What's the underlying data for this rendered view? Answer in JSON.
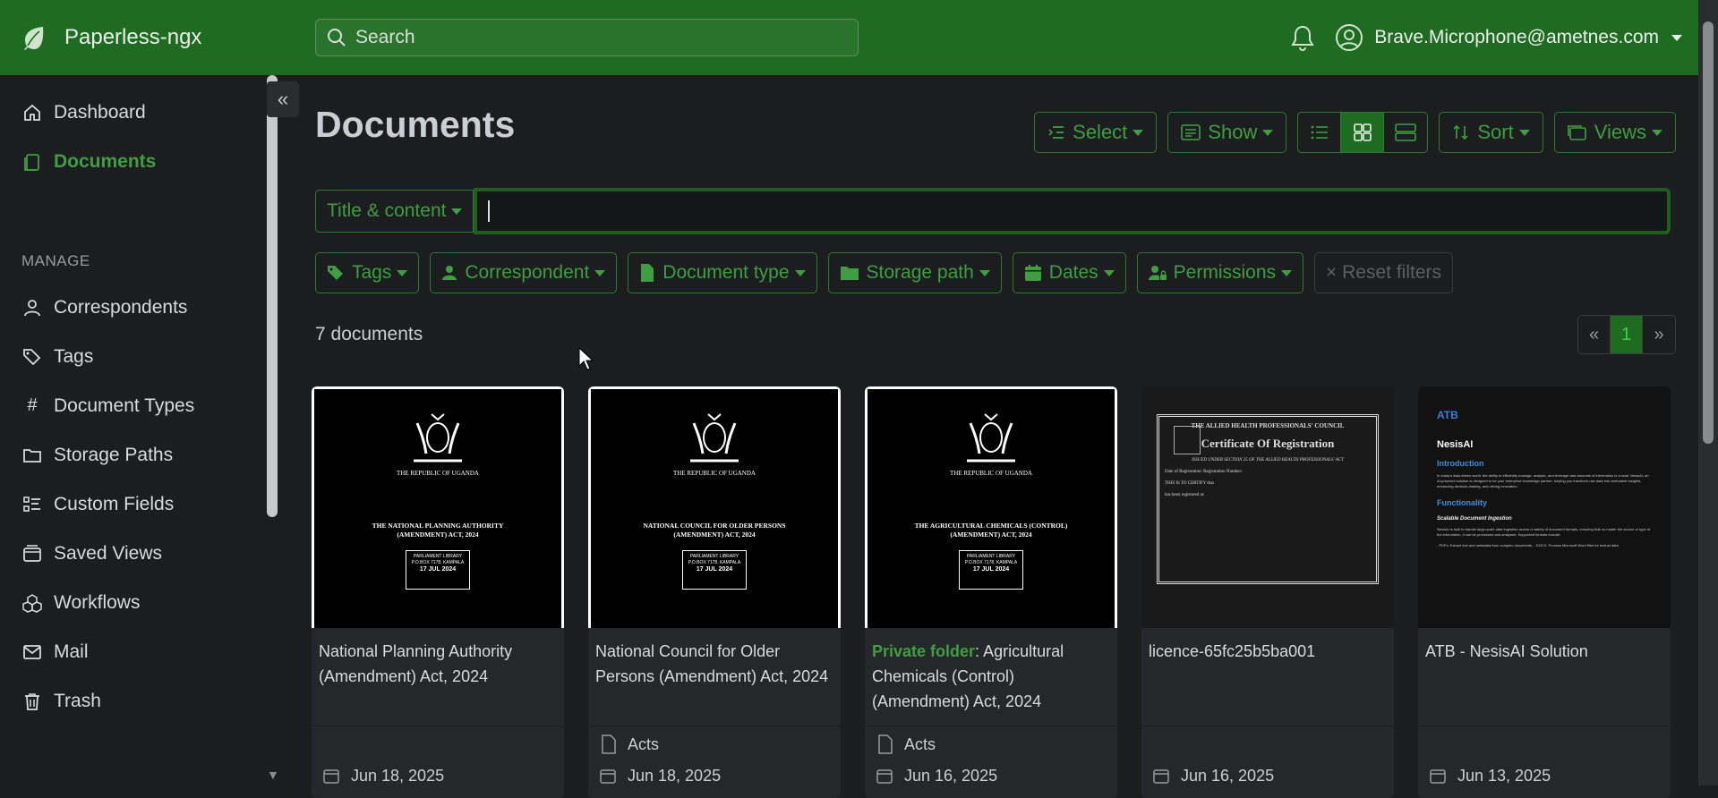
{
  "app": {
    "name": "Paperless-ngx"
  },
  "header": {
    "search_placeholder": "Search",
    "user": "Brave.Microphone@ametnes.com"
  },
  "sidebar": {
    "items": [
      {
        "label": "Dashboard",
        "icon": "house-icon",
        "active": false
      },
      {
        "label": "Documents",
        "icon": "files-icon",
        "active": true
      }
    ],
    "manage_label": "MANAGE",
    "manage_items": [
      {
        "label": "Correspondents",
        "icon": "person-icon"
      },
      {
        "label": "Tags",
        "icon": "tags-icon"
      },
      {
        "label": "Document Types",
        "icon": "hash-icon"
      },
      {
        "label": "Storage Paths",
        "icon": "folder-icon"
      },
      {
        "label": "Custom Fields",
        "icon": "ui-checks-icon"
      },
      {
        "label": "Saved Views",
        "icon": "window-stack-icon"
      },
      {
        "label": "Workflows",
        "icon": "boxes-icon"
      },
      {
        "label": "Mail",
        "icon": "envelope-icon"
      },
      {
        "label": "Trash",
        "icon": "trash-icon"
      }
    ]
  },
  "main": {
    "title": "Documents",
    "toolbar": {
      "select": "Select",
      "show": "Show",
      "sort": "Sort",
      "views": "Views"
    },
    "text_filter_mode": "Title & content",
    "filters": {
      "tags": "Tags",
      "correspondent": "Correspondent",
      "document_type": "Document type",
      "storage_path": "Storage path",
      "dates": "Dates",
      "permissions": "Permissions",
      "reset": "× Reset filters"
    },
    "doc_count": "7 documents",
    "pager": {
      "prev": "«",
      "current": "1",
      "next": "»"
    }
  },
  "documents": [
    {
      "title": "National Planning Authority (Amendment) Act, 2024",
      "private_prefix": "",
      "doc_type": "",
      "date": "Jun 18, 2025",
      "thumb": {
        "kind": "uganda",
        "republic": "THE REPUBLIC OF UGANDA",
        "act_line1": "THE NATIONAL PLANNING AUTHORITY",
        "act_line2": "(AMENDMENT) ACT, 2024",
        "stamp_top": "PARLIAMENT LIBRARY",
        "stamp_mid": "P.O.BOX 7178, KAMPALA",
        "stamp_date": "17 JUL 2024"
      }
    },
    {
      "title": "National Council for Older Persons (Amendment) Act, 2024",
      "private_prefix": "",
      "doc_type": "Acts",
      "date": "Jun 18, 2025",
      "thumb": {
        "kind": "uganda",
        "republic": "THE REPUBLIC OF UGANDA",
        "act_line1": "NATIONAL COUNCIL FOR OLDER PERSONS",
        "act_line2": "(AMENDMENT) ACT, 2024",
        "stamp_top": "PARLIAMENT LIBRARY",
        "stamp_mid": "P.O.BOX 7178, KAMPALA",
        "stamp_date": "17 JUL 2024"
      }
    },
    {
      "title": "Agricultural Chemicals (Control) (Amendment) Act, 2024",
      "private_prefix": "Private folder",
      "doc_type": "Acts",
      "date": "Jun 16, 2025",
      "thumb": {
        "kind": "uganda",
        "republic": "THE REPUBLIC OF UGANDA",
        "act_line1": "THE AGRICULTURAL CHEMICALS (CONTROL)",
        "act_line2": "(AMENDMENT) ACT, 2024",
        "stamp_top": "PARLIAMENT LIBRARY",
        "stamp_mid": "P.O.BOX 7178, KAMPALA",
        "stamp_date": "17 JUL 2024"
      }
    },
    {
      "title": "licence-65fc25b5ba001",
      "private_prefix": "",
      "doc_type": "",
      "date": "Jun 16, 2025",
      "thumb": {
        "kind": "cert",
        "head": "THE ALLIED HEALTH PROFESSIONALS' COUNCIL",
        "title": "Certificate Of Registration",
        "sub": "ISSUED UNDER SECTION 25 OF THE ALLIED HEALTH PROFESSIONALS' ACT",
        "l1": "Date of Registration:        Registration Number:",
        "l2": "THIS IS TO CERTIFY that",
        "l3": "has been registered as"
      }
    },
    {
      "title": "ATB - NesisAI Solution",
      "private_prefix": "",
      "doc_type": "",
      "date": "Jun 13, 2025",
      "thumb": {
        "kind": "atb",
        "logo": "ATB",
        "heading": "NesisAI",
        "h1": "Introduction",
        "p1": "In today's data-driven world, the ability to efficiently manage, analyse, and leverage vast amounts of information is crucial. NesisAI, an AI-powered solution is designed to be your enterprise knowledge partner; helping you transform raw data into actionable insights, enhancing decision-making, and driving innovation.",
        "h2": "Functionality",
        "hi": "Scalable Document Ingestion",
        "p2": "NesisAI is built to handle large-scale data ingestion across a variety of document formats, ensuring that no matter the source or type of the information, it can be processed and analysed. Supported formats include:",
        "p3": "- PDFs: Extract text and metadata from complex documents.  - DOCX: Process Microsoft Word files for textual data."
      }
    }
  ],
  "colors": {
    "header": "#1f6b21",
    "accent": "#3f9e42",
    "background": "#1c1d1f"
  }
}
